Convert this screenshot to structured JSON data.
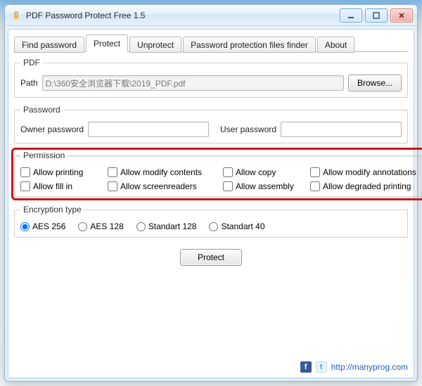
{
  "window": {
    "title": "PDF Password Protect Free 1.5"
  },
  "tabs": {
    "find_password": "Find password",
    "protect": "Protect",
    "unprotect": "Unprotect",
    "files_finder": "Password protection files finder",
    "about": "About",
    "active": "protect"
  },
  "pdf": {
    "legend": "PDF",
    "path_label": "Path",
    "path_value": "D:\\360安全浏览器下载\\2019_PDF.pdf",
    "browse": "Browse..."
  },
  "password": {
    "legend": "Password",
    "owner_label": "Owner password",
    "owner_value": "",
    "user_label": "User password",
    "user_value": ""
  },
  "permission": {
    "legend": "Permission",
    "allow_printing": "Allow printing",
    "allow_modify_contents": "Allow modify contents",
    "allow_copy": "Allow copy",
    "allow_modify_annotations": "Allow modify annotations",
    "allow_fill_in": "Allow fill in",
    "allow_screenreaders": "Allow screenreaders",
    "allow_assembly": "Allow assembly",
    "allow_degraded_printing": "Allow degraded printing"
  },
  "encryption": {
    "legend": "Encryption type",
    "aes256": "AES 256",
    "aes128": "AES 128",
    "std128": "Standart 128",
    "std40": "Standart 40",
    "selected": "aes256"
  },
  "actions": {
    "protect": "Protect"
  },
  "footer": {
    "url": "http://manyprog.com",
    "fb": "f",
    "tw": "t"
  }
}
